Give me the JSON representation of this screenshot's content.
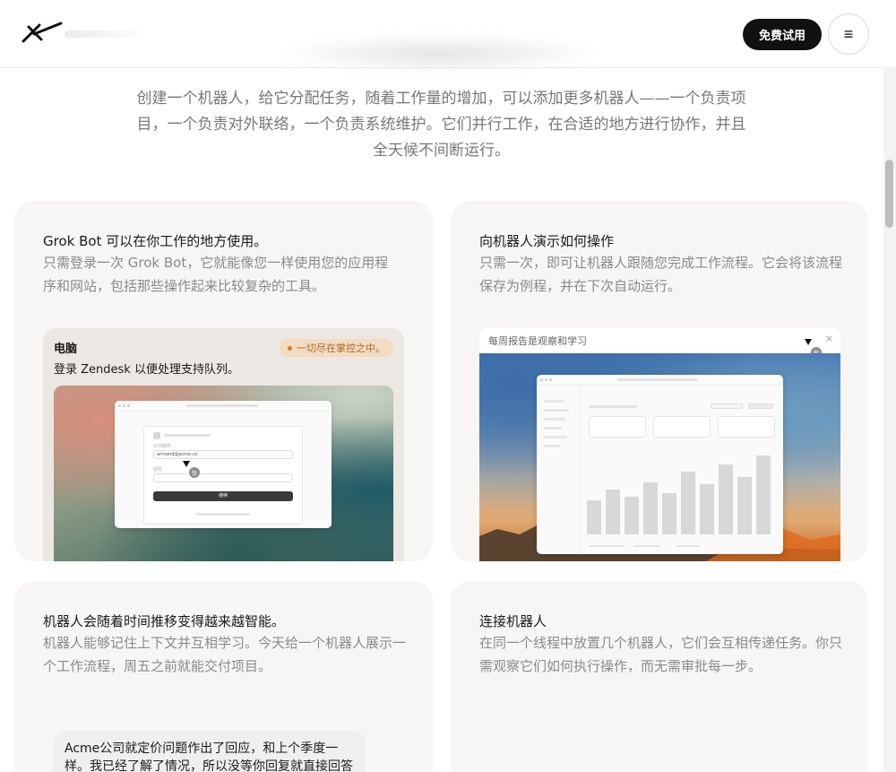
{
  "header": {
    "cta_label": "免费试用",
    "menu_icon": "hamburger-icon",
    "menu_glyph": "≡"
  },
  "intro": {
    "text": "创建一个机器人，给它分配任务，随着工作量的增加，可以添加更多机器人——一个负责项目，一个负责对外联络，一个负责系统维护。它们并行工作，在合适的地方进行协作，并且全天候不间断运行。"
  },
  "cards": [
    {
      "title": "Grok Bot 可以在你工作的地方使用。",
      "desc": "只需登录一次 Grok Bot，它就能像您一样使用您的应用程序和网站，包括那些操作起来比较复杂的工具。",
      "panel": {
        "title": "电脑",
        "subtitle": "登录 Zendesk 以便处理支持队列。",
        "status": "一切尽在掌控之中。",
        "mock": {
          "label_email": "工作邮件",
          "email_value": "armand@acme.co",
          "label_password": "密码",
          "button": "继续",
          "cursor_badge": "你"
        }
      }
    },
    {
      "title": "向机器人演示如何操作",
      "desc": "只需一次，即可让机器人跟随您完成工作流程。它会将该流程保存为例程，并在下次自动运行。",
      "panel": {
        "title": "每周报告是观察和学习",
        "close": "×",
        "cursor_badge": "你",
        "bars": [
          0.38,
          0.5,
          0.42,
          0.58,
          0.46,
          0.7,
          0.56,
          0.78,
          0.64,
          0.88
        ]
      }
    },
    {
      "title": "机器人会随着时间推移变得越来越智能。",
      "desc": "机器人能够记住上下文并互相学习。今天给一个机器人展示一个工作流程，周五之前就能交付项目。",
      "bubble": "Acme公司就定价问题作出了回应，和上个季度一样。我已经了解了情况，所以没等你回复就直接回答"
    },
    {
      "title": "连接机器人",
      "desc": "在同一个线程中放置几个机器人，它们会互相传递任务。你只需观察它们如何执行操作，而无需审批每一步。"
    }
  ]
}
